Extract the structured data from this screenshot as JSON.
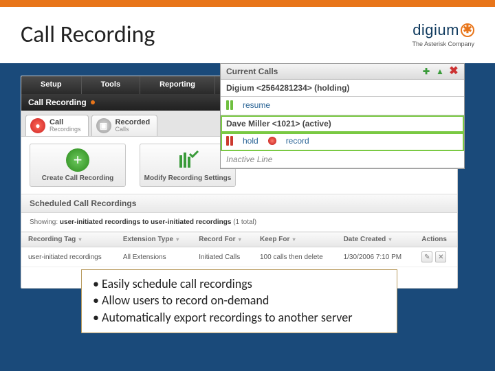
{
  "title": "Call Recording",
  "logo": {
    "name": "digium",
    "tagline": "The Asterisk Company"
  },
  "app": {
    "menu": [
      "Setup",
      "Tools",
      "Reporting"
    ],
    "breadcrumb": "Call Recording",
    "tabs": [
      {
        "main": "Call",
        "sub": "Recordings"
      },
      {
        "main": "Recorded",
        "sub": "Calls"
      }
    ],
    "actions": [
      {
        "label": "Create Call Recording"
      },
      {
        "label": "Modify Recording Settings"
      }
    ],
    "panel_head": "Scheduled Call Recordings",
    "showing_prefix": "Showing:",
    "showing_bold": "user-initiated recordings to user-initiated recordings",
    "showing_suffix": "(1 total)",
    "columns": [
      "Recording Tag",
      "Extension Type",
      "Record For",
      "Keep For",
      "Date Created",
      "Actions"
    ],
    "rows": [
      {
        "tag": "user-initiated recordings",
        "ext": "All Extensions",
        "rec": "Initiated Calls",
        "keep": "100 calls then delete",
        "date": "1/30/2006 7:10 PM"
      }
    ]
  },
  "popover": {
    "title": "Current Calls",
    "calls": [
      {
        "label": "Digium <2564281234> (holding)",
        "action": "resume",
        "bar_color": "#6fbf3f",
        "active": false
      },
      {
        "label": "Dave Miller <1021> (active)",
        "action1": "hold",
        "action2": "record",
        "bar_color": "#cc3a2e",
        "active": true
      }
    ],
    "inactive": "Inactive Line"
  },
  "bullets": [
    "Easily schedule call recordings",
    "Allow users to record on-demand",
    "Automatically export recordings to another server"
  ]
}
